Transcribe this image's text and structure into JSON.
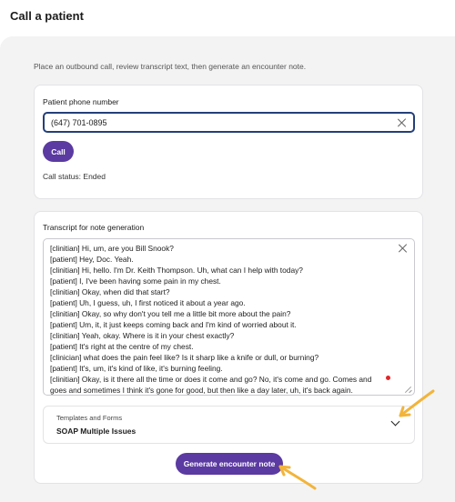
{
  "header": {
    "title": "Call a patient"
  },
  "intro": "Place an outbound call, review transcript text, then generate an encounter note.",
  "call_card": {
    "phone_label": "Patient phone number",
    "phone_value": "(647) 701-0895",
    "call_button": "Call",
    "status": "Call status: Ended"
  },
  "transcript_card": {
    "label": "Transcript for note generation",
    "lines": [
      "[clinitian] Hi, um, are you Bill Snook?",
      "[patient] Hey, Doc. Yeah.",
      "[clinitian] Hi, hello. I'm Dr. Keith Thompson. Uh, what can I help with today?",
      "[patient] I, I've been having some pain in my chest.",
      "[clinitian] Okay, when did that start?",
      "[patient] Uh, I guess, uh, I first noticed it about a year ago.",
      "[clinitian] Okay, so why don't you tell me a little bit more about the pain?",
      "[patient] Um, it, it just keeps coming back and I'm kind of worried about it.",
      "[clinitian] Yeah, okay. Where is it in your chest exactly?",
      "[patient] It's right at the centre of my chest.",
      "[clinician] what does the pain feel like? Is it sharp like a knife or dull, or burning?",
      "[patient] It's, um, it's kind of like, it's burning feeling.",
      "[clinitian] Okay, is it there all the time or does it come and go? No, it's come and go. Comes and",
      "goes and sometimes I think it's gone for good, but then like a day later, uh, it's back again."
    ],
    "templates_label": "Templates and Forms",
    "templates_value": "SOAP Multiple Issues",
    "generate_button": "Generate encounter note"
  },
  "colors": {
    "accent": "#5b3aa1",
    "focus_border": "#243f7a",
    "annotation_arrow": "#f2b43a"
  }
}
